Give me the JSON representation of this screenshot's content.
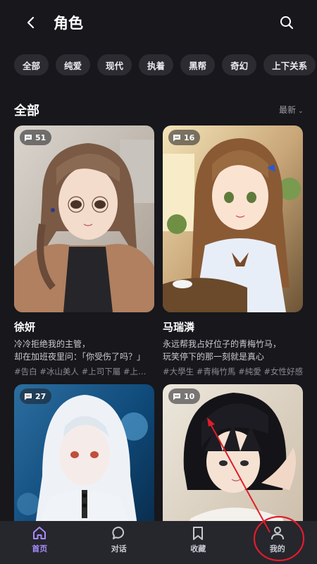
{
  "header": {
    "title": "角色"
  },
  "categories": [
    "全部",
    "纯爱",
    "现代",
    "执着",
    "黑帮",
    "奇幻",
    "上下关系"
  ],
  "section": {
    "title": "全部",
    "sort_label": "最新"
  },
  "cards": [
    {
      "count": "51",
      "name": "徐妍",
      "desc_line1": "冷冷拒绝我的主管，",
      "desc_line2": "却在加班夜里问：「你受伤了吗？」",
      "tags": "#告白 #冰山美人 #上司下屬 #上下关系"
    },
    {
      "count": "16",
      "name": "马瑞潾",
      "desc_line1": "永远帮我占好位子的青梅竹马，",
      "desc_line2": "玩笑停下的那一刻就是真心",
      "tags": "#大學生 #青梅竹馬 #純愛 #女性好感"
    },
    {
      "count": "27"
    },
    {
      "count": "10"
    }
  ],
  "nav": [
    {
      "label": "首页",
      "icon": "home-icon"
    },
    {
      "label": "对话",
      "icon": "chat-bubble-icon"
    },
    {
      "label": "收藏",
      "icon": "bookmark-icon"
    },
    {
      "label": "我的",
      "icon": "user-icon"
    }
  ],
  "colors": {
    "accent": "#a78bfa",
    "annotation": "#e11d2a",
    "background": "#17171c"
  }
}
